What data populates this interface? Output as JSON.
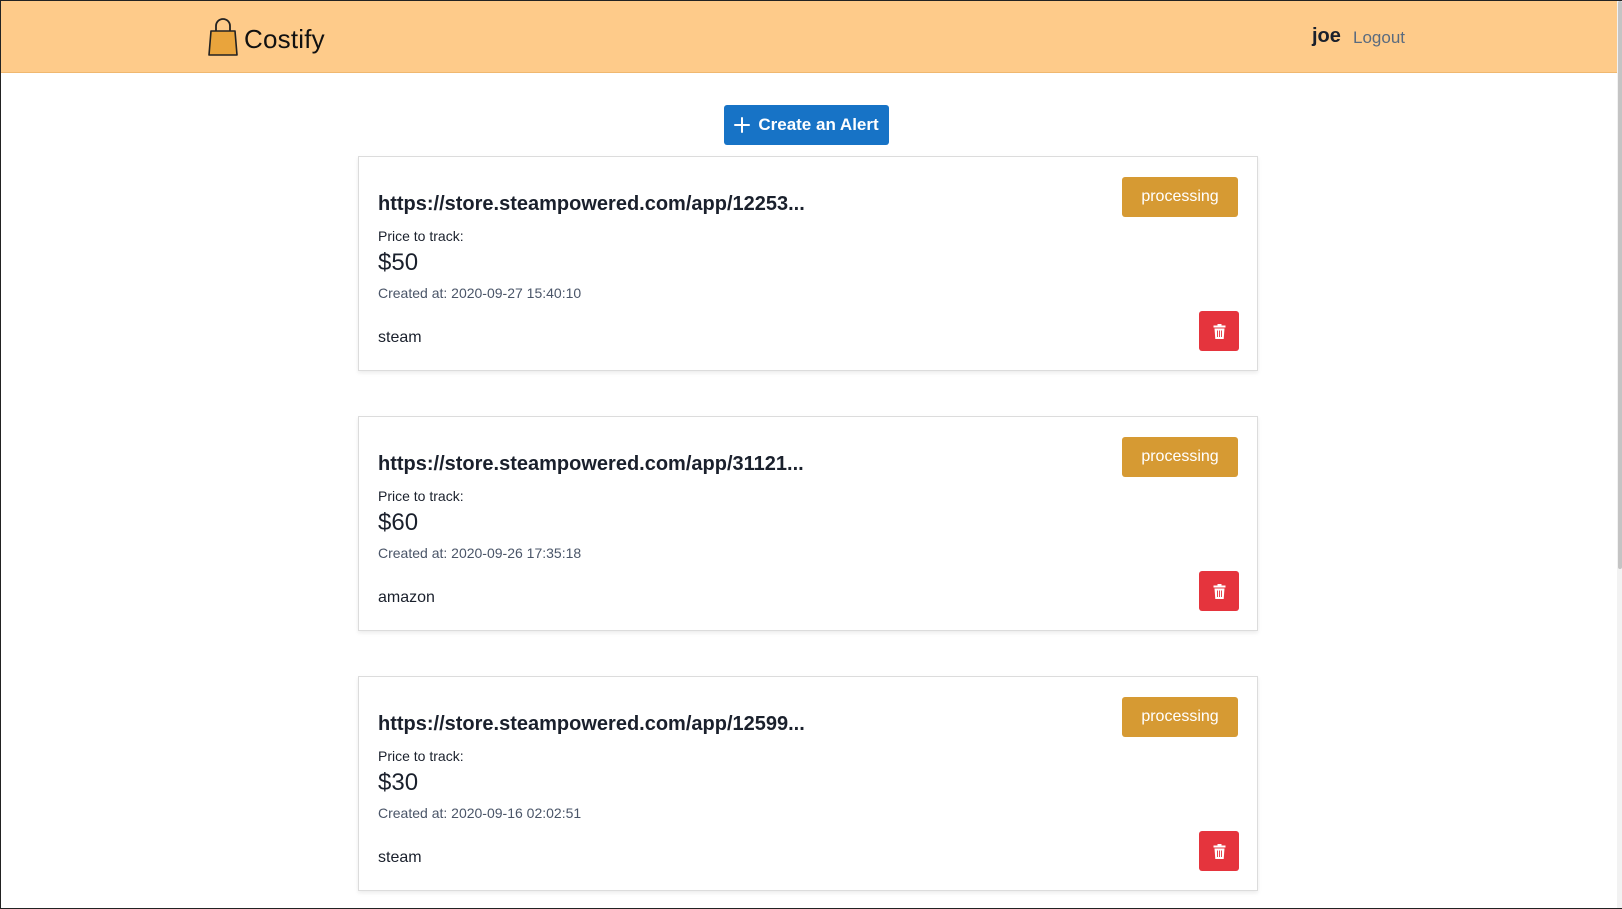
{
  "navbar": {
    "brand_name": "Costify",
    "user": "joe",
    "logout_label": "Logout",
    "logo_icon": "shopping-bag-icon"
  },
  "actions": {
    "create_label": "Create an Alert",
    "create_icon": "plus-icon"
  },
  "alerts": [
    {
      "url": "https://store.steampowered.com/app/12253...",
      "price_label": "Price to track:",
      "price": "$50",
      "created": "Created at: 2020-09-27 15:40:10",
      "store": "steam",
      "status": "processing",
      "delete_icon": "trash-icon"
    },
    {
      "url": "https://store.steampowered.com/app/31121...",
      "price_label": "Price to track:",
      "price": "$60",
      "created": "Created at: 2020-09-26 17:35:18",
      "store": "amazon",
      "status": "processing",
      "delete_icon": "trash-icon"
    },
    {
      "url": "https://store.steampowered.com/app/12599...",
      "price_label": "Price to track:",
      "price": "$30",
      "created": "Created at: 2020-09-16 02:02:51",
      "store": "steam",
      "status": "processing",
      "delete_icon": "trash-icon"
    }
  ],
  "colors": {
    "navbar_bg": "#fecb8a",
    "primary": "#1773c6",
    "status_processing": "#d69a33",
    "danger": "#e5343d"
  }
}
